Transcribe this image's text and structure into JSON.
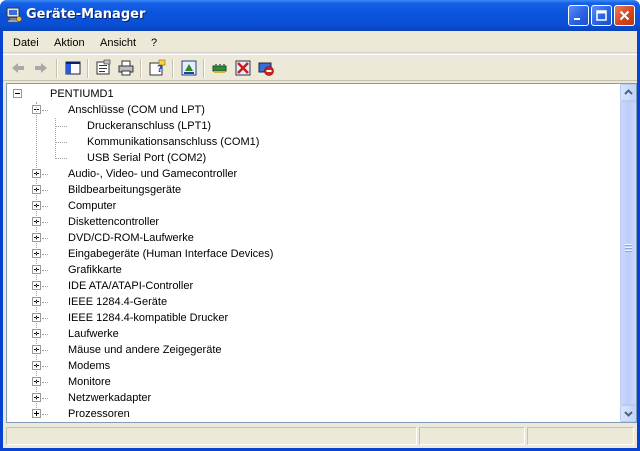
{
  "window": {
    "title": "Geräte-Manager",
    "accent_color": "#0a53db"
  },
  "menu": [
    "Datei",
    "Aktion",
    "Ansicht",
    "?"
  ],
  "toolbar": {
    "buttons": [
      {
        "name": "back-button",
        "icon": "arrow-left-icon"
      },
      {
        "name": "forward-button",
        "icon": "arrow-right-icon"
      },
      {
        "name": "show-hide-console-tree-button",
        "icon": "console-tree-icon"
      },
      {
        "name": "properties-button",
        "icon": "properties-icon"
      },
      {
        "name": "print-button",
        "icon": "printer-icon"
      },
      {
        "name": "help-button",
        "icon": "help-icon"
      },
      {
        "name": "update-driver-button",
        "icon": "update-driver-icon"
      },
      {
        "name": "scan-hardware-button",
        "icon": "scan-hardware-icon"
      },
      {
        "name": "uninstall-button",
        "icon": "uninstall-icon"
      },
      {
        "name": "disable-button",
        "icon": "disable-icon"
      }
    ]
  },
  "tree": {
    "root": {
      "label": "PENTIUMD1",
      "icon": "computer-icon",
      "expanded": true
    },
    "categories": [
      {
        "label": "Anschlüsse (COM und LPT)",
        "icon": "port-icon",
        "expanded": true,
        "children": [
          {
            "label": "Druckeranschluss (LPT1)",
            "icon": "port-icon"
          },
          {
            "label": "Kommunikationsanschluss (COM1)",
            "icon": "port-icon"
          },
          {
            "label": "USB Serial Port (COM2)",
            "icon": "port-icon"
          }
        ]
      },
      {
        "label": "Audio-, Video- und Gamecontroller",
        "icon": "speaker-icon",
        "expanded": false
      },
      {
        "label": "Bildbearbeitungsgeräte",
        "icon": "camera-icon",
        "expanded": false
      },
      {
        "label": "Computer",
        "icon": "monitor-icon",
        "expanded": false
      },
      {
        "label": "Diskettencontroller",
        "icon": "controller-icon",
        "expanded": false
      },
      {
        "label": "DVD/CD-ROM-Laufwerke",
        "icon": "cd-drive-icon",
        "expanded": false
      },
      {
        "label": "Eingabegeräte (Human Interface Devices)",
        "icon": "hid-icon",
        "expanded": false
      },
      {
        "label": "Grafikkarte",
        "icon": "display-adapter-icon",
        "expanded": false
      },
      {
        "label": "IDE ATA/ATAPI-Controller",
        "icon": "controller-icon",
        "expanded": false
      },
      {
        "label": "IEEE 1284.4-Geräte",
        "icon": "printer-icon",
        "expanded": false
      },
      {
        "label": "IEEE 1284.4-kompatible Drucker",
        "icon": "printer-icon",
        "expanded": false
      },
      {
        "label": "Laufwerke",
        "icon": "disk-drive-icon",
        "expanded": false
      },
      {
        "label": "Mäuse und andere Zeigegeräte",
        "icon": "mouse-icon",
        "expanded": false
      },
      {
        "label": "Modems",
        "icon": "modem-icon",
        "expanded": false
      },
      {
        "label": "Monitore",
        "icon": "monitor-icon",
        "expanded": false
      },
      {
        "label": "Netzwerkadapter",
        "icon": "network-adapter-icon",
        "expanded": false
      },
      {
        "label": "Prozessoren",
        "icon": "processor-icon",
        "expanded": false
      }
    ]
  },
  "statusbar": {
    "text": ""
  }
}
